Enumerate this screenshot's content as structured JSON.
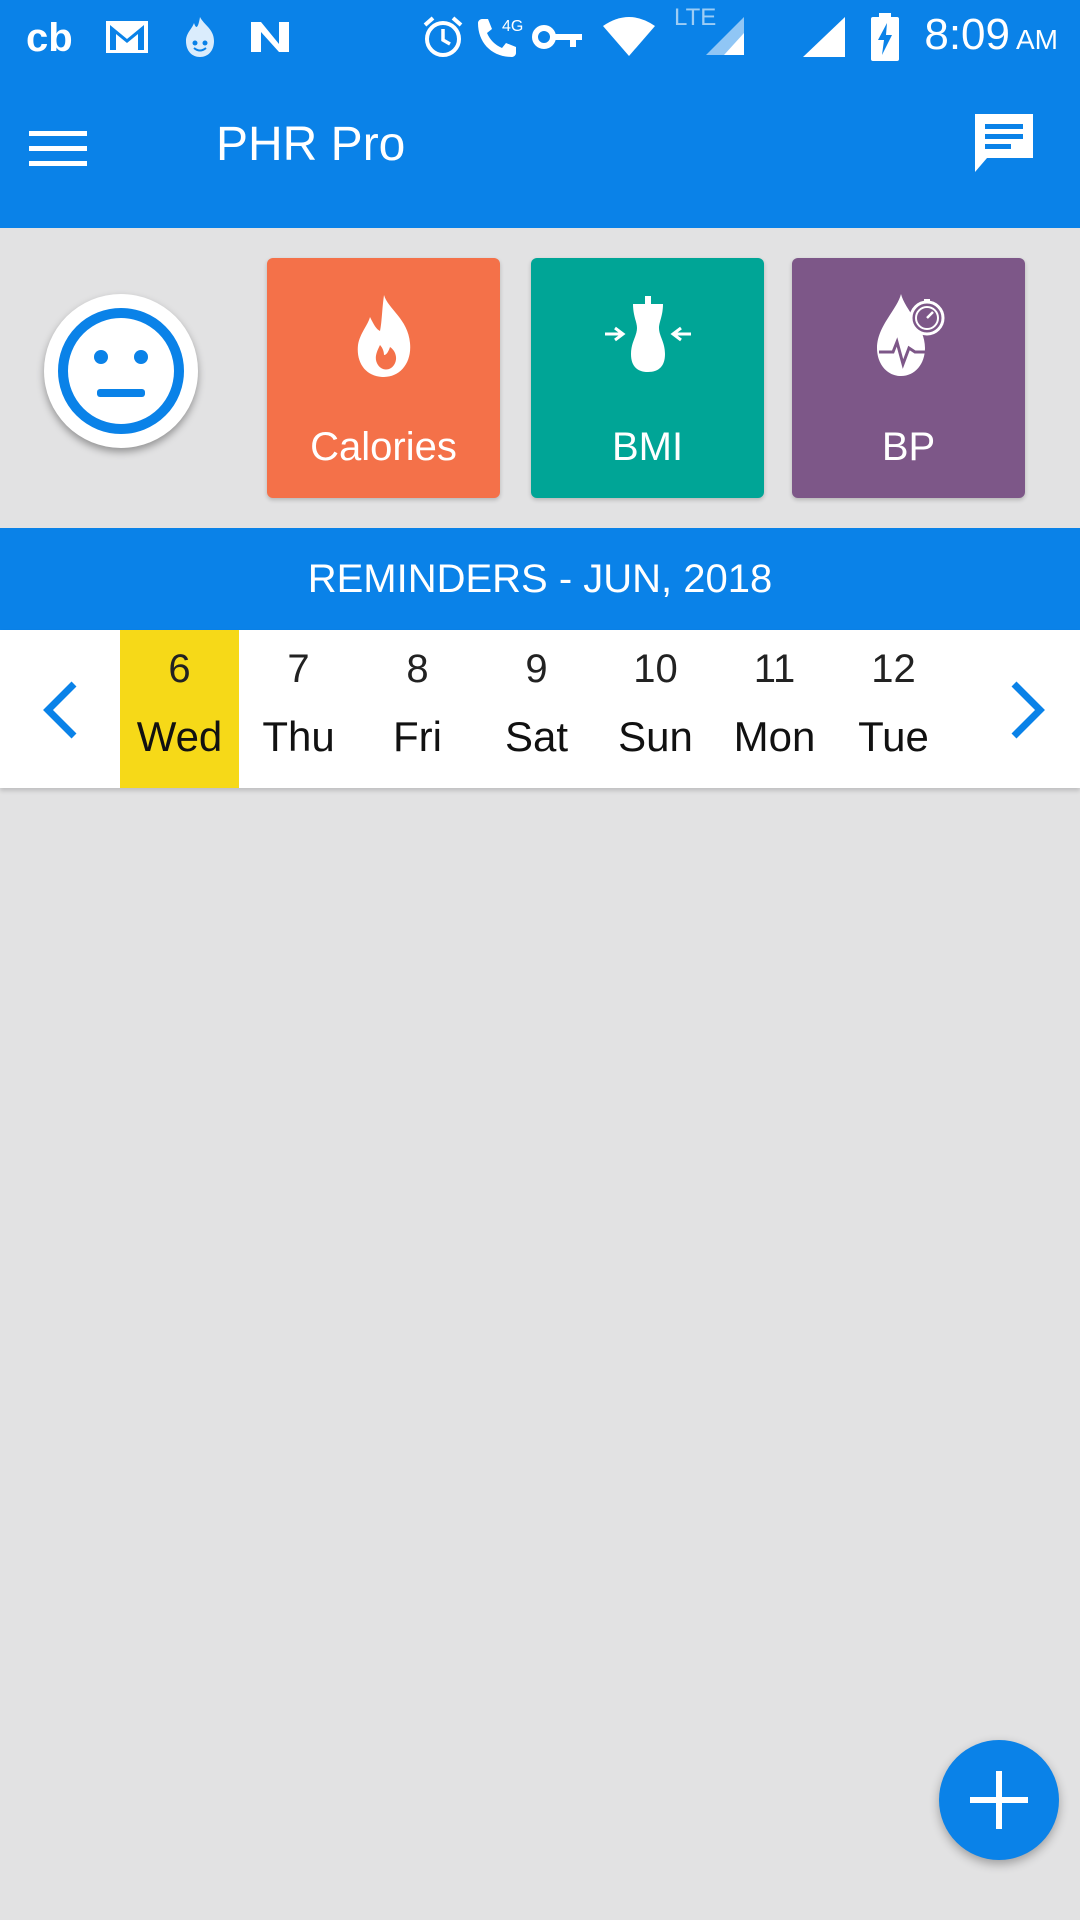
{
  "status_bar": {
    "time": "8:09",
    "ampm": "AM",
    "network_label": "LTE",
    "call_label": "4G",
    "icons": [
      "cb-app-icon",
      "gmail-icon",
      "hotspot-shield-icon",
      "n-app-icon",
      "alarm-icon",
      "volte-call-icon",
      "vpn-key-icon",
      "wifi-icon",
      "signal-icon",
      "signal-icon",
      "battery-charging-icon"
    ]
  },
  "app_bar": {
    "title": "PHR Pro",
    "menu_icon": "hamburger-menu-icon",
    "chat_icon": "chat-message-icon"
  },
  "tiles": [
    {
      "label": "Calories",
      "icon": "flame-icon",
      "color": "#f47149"
    },
    {
      "label": "BMI",
      "icon": "body-measure-icon",
      "color": "#00a596"
    },
    {
      "label": "BP",
      "icon": "blood-pressure-drop-icon",
      "color": "#7d5788"
    }
  ],
  "mood_icon": "neutral-face-icon",
  "reminders": {
    "header": "REMINDERS - JUN, 2018",
    "days": [
      {
        "num": "6",
        "name": "Wed",
        "selected": true
      },
      {
        "num": "7",
        "name": "Thu"
      },
      {
        "num": "8",
        "name": "Fri"
      },
      {
        "num": "9",
        "name": "Sat"
      },
      {
        "num": "10",
        "name": "Sun"
      },
      {
        "num": "11",
        "name": "Mon"
      },
      {
        "num": "12",
        "name": "Tue"
      }
    ]
  },
  "colors": {
    "primary": "#0a82e8",
    "selected_day": "#f6d918",
    "background": "#e2e2e3"
  }
}
